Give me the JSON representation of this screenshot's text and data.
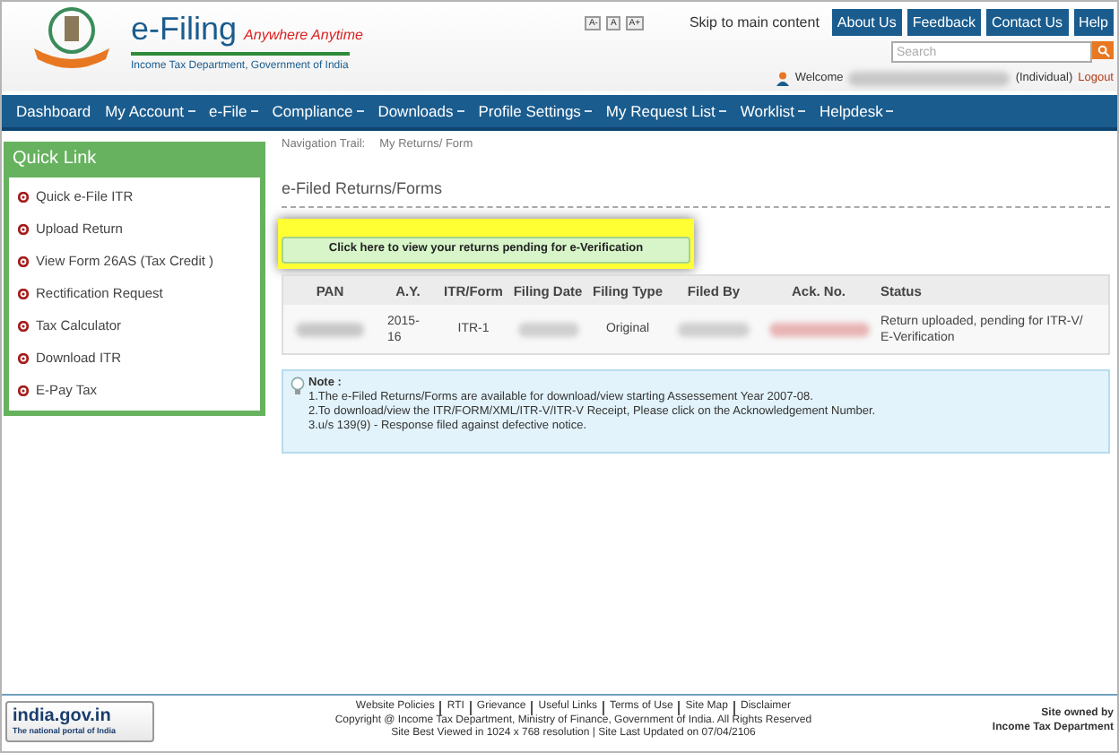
{
  "header": {
    "title": "e-Filing",
    "tagline": "Anywhere Anytime",
    "subtitle": "Income Tax Department, Government of India",
    "font_buttons": [
      "A-",
      "A",
      "A+"
    ],
    "skip_link": "Skip to main content",
    "top_buttons": [
      "About Us",
      "Feedback",
      "Contact Us",
      "Help"
    ],
    "search": {
      "placeholder": "Search"
    },
    "welcome": "Welcome",
    "user_type": "(Individual)",
    "logout": "Logout"
  },
  "nav": [
    "Dashboard",
    "My Account",
    "e-File",
    "Compliance",
    "Downloads",
    "Profile Settings",
    "My Request List",
    "Worklist",
    "Helpdesk"
  ],
  "nav_dropdown": [
    false,
    true,
    true,
    true,
    true,
    true,
    true,
    true,
    true
  ],
  "sidebar": {
    "title": "Quick Link",
    "items": [
      "Quick e-File ITR",
      "Upload Return",
      "View Form 26AS (Tax Credit )",
      "Rectification Request",
      "Tax Calculator",
      "Download ITR",
      "E-Pay Tax"
    ]
  },
  "breadcrumb": {
    "label": "Navigation Trail:",
    "path": "My Returns/ Form"
  },
  "section_title": "e-Filed Returns/Forms",
  "pending_button": "Click here to view your returns pending for e-Verification",
  "table": {
    "columns": [
      "PAN",
      "A.Y.",
      "ITR/Form",
      "Filing Date",
      "Filing Type",
      "Filed By",
      "Ack. No.",
      "Status"
    ],
    "rows": [
      {
        "ay": "2015-16",
        "form": "ITR-1",
        "filing_type": "Original",
        "status": "Return uploaded, pending for ITR-V/ E-Verification"
      }
    ]
  },
  "note": {
    "title": "Note :",
    "lines": [
      "1.The e-Filed Returns/Forms are available for download/view starting Assessement Year 2007-08.",
      "2.To download/view the ITR/FORM/XML/ITR-V/ITR-V Receipt, Please click on the Acknowledgement Number.",
      "3.u/s 139(9) - Response filed against defective notice."
    ]
  },
  "footer": {
    "logo_title": "india.gov.in",
    "logo_subtitle": "The national portal of India",
    "links": [
      "Website Policies",
      "RTI",
      "Grievance",
      "Useful Links",
      "Terms of Use",
      "Site Map",
      "Disclaimer"
    ],
    "copyright": "Copyright @ Income Tax Department, Ministry of Finance, Government of India. All Rights Reserved",
    "best_viewed": "Site Best Viewed in 1024 x 768 resolution | Site Last Updated on 07/04/2106",
    "owner_line1": "Site owned by",
    "owner_line2": "Income Tax Department"
  }
}
